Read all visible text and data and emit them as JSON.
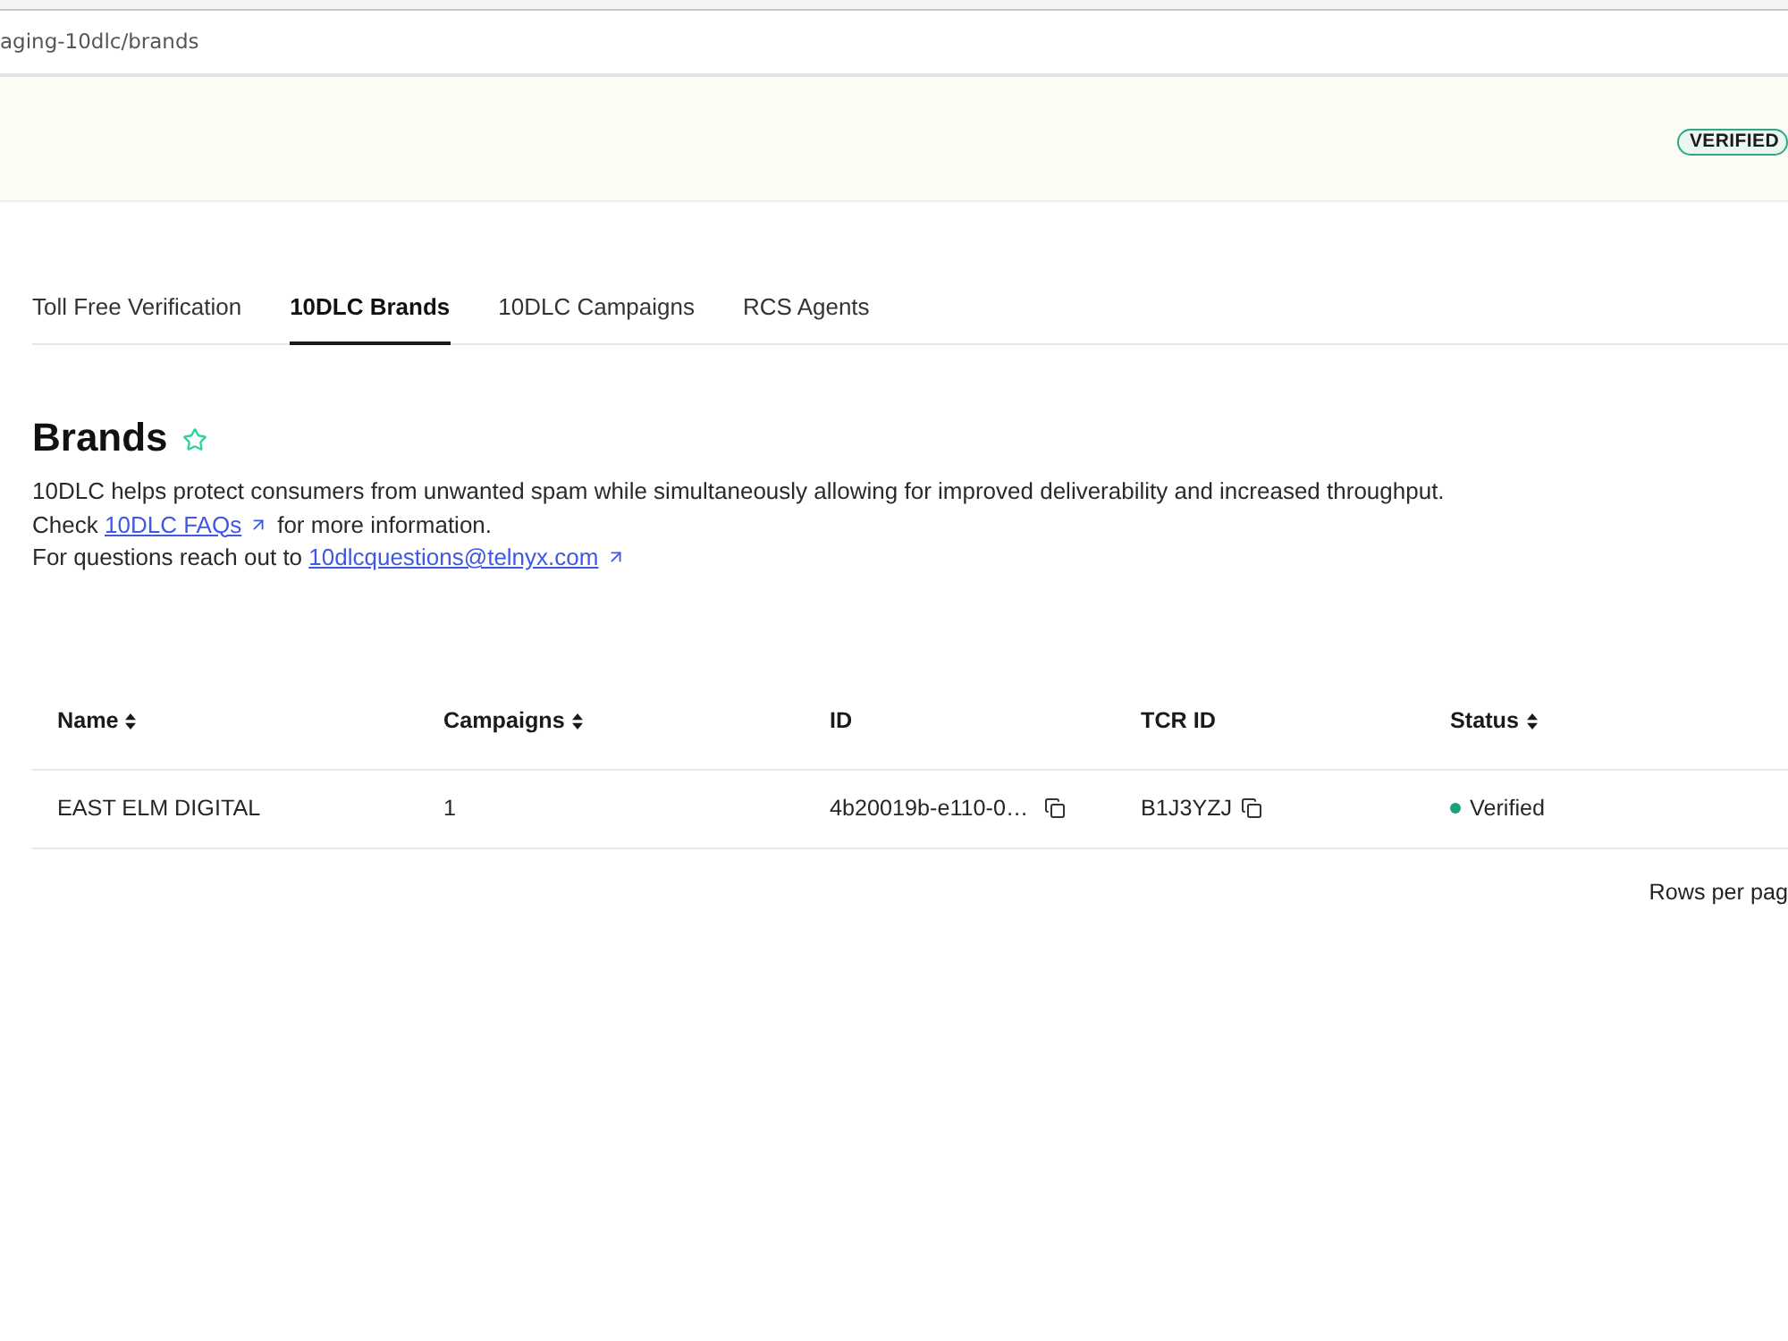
{
  "browser": {
    "address": "aging-10dlc/brands"
  },
  "banner": {
    "badge": "VERIFIED"
  },
  "tabs": [
    {
      "label": "Toll Free Verification",
      "selected": false
    },
    {
      "label": "10DLC Brands",
      "selected": true
    },
    {
      "label": "10DLC Campaigns",
      "selected": false
    },
    {
      "label": "RCS Agents",
      "selected": false
    }
  ],
  "header": {
    "title": "Brands",
    "description": [
      {
        "text": "10DLC helps protect consumers from unwanted spam while simultaneously allowing for improved deliverability and increased throughput."
      },
      {
        "text": "Check",
        "link": "10DLC FAQs",
        "after": "for more information."
      },
      {
        "text": "For questions reach out to",
        "link": "10dlcquestions@telnyx.com"
      }
    ]
  },
  "table": {
    "columns": [
      {
        "label": "Name",
        "sortable": true
      },
      {
        "label": "Campaigns",
        "sortable": true
      },
      {
        "label": "ID",
        "sortable": false
      },
      {
        "label": "TCR ID",
        "sortable": false
      },
      {
        "label": "Status",
        "sortable": true
      }
    ],
    "rows": [
      {
        "cells": [
          {
            "kind": "text",
            "text": "EAST ELM DIGITAL"
          },
          {
            "kind": "text",
            "text": "1"
          },
          {
            "kind": "copy",
            "text": "4b20019b-e110-0…"
          },
          {
            "kind": "copy",
            "text": "B1J3YZJ"
          },
          {
            "kind": "status",
            "text": "Verified",
            "color": "#1aa37a"
          }
        ]
      }
    ]
  },
  "pagination": {
    "label": "Rows per pag"
  }
}
